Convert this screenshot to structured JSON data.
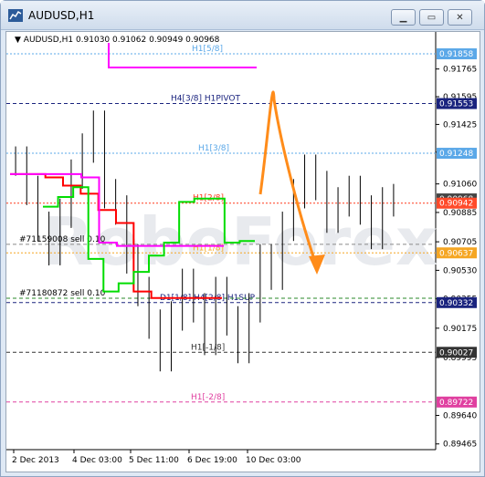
{
  "window": {
    "title": "AUDUSD,H1",
    "buttons": {
      "minimize": "▁",
      "maximize": "▭",
      "close": "✕"
    }
  },
  "chart_header": {
    "dropdown": "▼",
    "symbol": "AUDUSD,H1",
    "ohlc": "0.91030 0.91062 0.90949 0.90968"
  },
  "colors": {
    "candles": "#000000",
    "red_line": "#ff0000",
    "magenta_line": "#ff00ff",
    "green_line": "#00dd00",
    "arrow": "#ff8c1a",
    "watermark": "#e8eaee"
  },
  "levels": [
    {
      "id": "h1-5-8",
      "label": "H1[5/8]",
      "price_tag": "0.91858",
      "value": 0.91858,
      "color": "#5ba8e8",
      "tag_bg": "#5ba8e8",
      "style": "dotted"
    },
    {
      "id": "h4-3-8",
      "label": "H4[3/8] H1PIVOT",
      "price_tag": "0.91553",
      "value": 0.91553,
      "color": "#1a237e",
      "tag_bg": "#1a237e",
      "style": "dashed"
    },
    {
      "id": "h1-3-8",
      "label": "H1[3/8]",
      "price_tag": "0.91248",
      "value": 0.91248,
      "color": "#5ba8e8",
      "tag_bg": "#5ba8e8",
      "style": "dotted"
    },
    {
      "id": "bid",
      "label": "",
      "price_tag": "0.90968",
      "value": 0.90968,
      "color": "#888888",
      "tag_bg": "#444444",
      "style": "none"
    },
    {
      "id": "sell-stop",
      "label": "",
      "price_tag": "0.90942",
      "value": 0.90942,
      "color": "#ff3b1f",
      "tag_bg": "#ff4a2a",
      "style": "dotted"
    },
    {
      "id": "h1-2-8",
      "label": "H1[2/8]",
      "price_tag": "",
      "value": 0.90942,
      "color": "#ff3b1f",
      "tag_bg": "",
      "style": "none"
    },
    {
      "id": "h1-1-8",
      "label": "H1[1/8]",
      "price_tag": "0.90637",
      "value": 0.90637,
      "color": "#f5a623",
      "tag_bg": "#f5a623",
      "style": "dotted"
    },
    {
      "id": "h4-2-8",
      "label": "D1[1/8] H4[2/8] H1SUP",
      "price_tag": "0.90332",
      "value": 0.90332,
      "color": "#1a237e",
      "tag_bg": "#1a237e",
      "style": "dashed"
    },
    {
      "id": "h1-m1-8",
      "label": "H1[-1/8]",
      "price_tag": "0.90027",
      "value": 0.90027,
      "color": "#333333",
      "tag_bg": "#333333",
      "style": "dashed"
    },
    {
      "id": "h1-m2-8",
      "label": "H1[-2/8]",
      "price_tag": "0.89722",
      "value": 0.89722,
      "color": "#e040a0",
      "tag_bg": "#e040a0",
      "style": "dashed"
    }
  ],
  "order_labels": [
    {
      "text": "#71159008 sell 0.10",
      "value": 0.90695
    },
    {
      "text": "#71180872 sell 0.10",
      "value": 0.90364
    }
  ],
  "watermark": "RoboForex",
  "y_axis": {
    "ticks": [
      "0.91765",
      "0.91595",
      "0.91425",
      "0.91255",
      "0.91060",
      "0.90885",
      "0.90705",
      "0.90530",
      "0.90355",
      "0.90175",
      "0.89995",
      "0.89640",
      "0.89465"
    ],
    "range": [
      0.8943,
      0.9197
    ]
  },
  "x_axis": {
    "ticks": [
      "2 Dec 2013",
      "4 Dec 03:00",
      "5 Dec 11:00",
      "6 Dec 19:00",
      "10 Dec 03:00"
    ]
  },
  "chart_data": {
    "type": "line",
    "title": "",
    "xlabel": "",
    "ylabel": "",
    "ylim": [
      0.8943,
      0.9197
    ],
    "x_categories": [
      "2 Dec 2013",
      "4 Dec 03:00",
      "5 Dec 11:00",
      "6 Dec 19:00",
      "10 Dec 03:00"
    ],
    "series": [
      {
        "values": [
          0.9112,
          0.9112,
          0.911,
          0.9105,
          0.91,
          0.909,
          0.9082,
          0.904,
          0.9036,
          0.9036,
          0.9036,
          0.9036
        ]
      },
      {
        "values": [
          0.9112,
          0.9112,
          0.9112,
          0.9112,
          0.911,
          0.907,
          0.9068,
          0.9068,
          0.9068,
          0.9068,
          0.9068,
          0.9068
        ]
      },
      {
        "values": [
          0.9092,
          0.9098,
          0.9104,
          0.906,
          0.904,
          0.9045,
          0.9052,
          0.9062,
          0.907,
          0.9095,
          0.9097,
          0.9097,
          0.907,
          0.9071
        ]
      }
    ],
    "close_prices": [
      0.912,
      0.9102,
      0.908,
      0.9065,
      0.9088,
      0.9112,
      0.9128,
      0.9142,
      0.91,
      0.909,
      0.906,
      0.904,
      0.902,
      0.9,
      0.9025,
      0.9045,
      0.903,
      0.901,
      0.904,
      0.9022,
      0.9005,
      0.903,
      0.906,
      0.905,
      0.908,
      0.91,
      0.9115,
      0.9105,
      0.9085,
      0.9095,
      0.9102,
      0.909,
      0.9075,
      0.9095,
      0.9097
    ]
  }
}
